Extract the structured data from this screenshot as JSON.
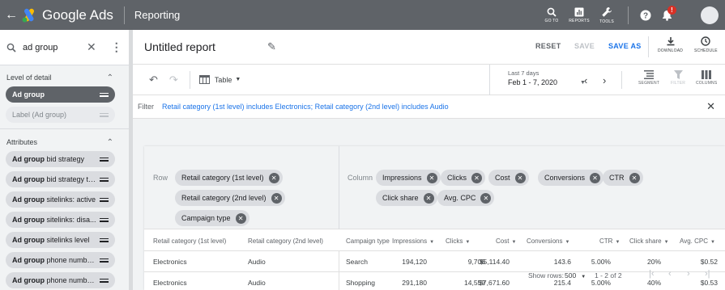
{
  "topbar": {
    "brand": "Google Ads",
    "section": "Reporting",
    "tools": [
      {
        "label": "GO TO",
        "icon": "search-icon"
      },
      {
        "label": "REPORTS",
        "icon": "reports-icon"
      },
      {
        "label": "TOOLS",
        "icon": "wrench-icon"
      }
    ],
    "notification_badge": "!"
  },
  "sidebar": {
    "search_value": "ad group",
    "level_header": "Level of detail",
    "level_items": [
      {
        "prefix": "Ad group",
        "rest": "",
        "state": "selected"
      },
      {
        "prefix": "",
        "rest": "Label (Ad group)",
        "state": "disabled"
      }
    ],
    "attributes_header": "Attributes",
    "attribute_items": [
      {
        "prefix": "Ad group",
        "rest": " bid strategy"
      },
      {
        "prefix": "Ad group",
        "rest": " bid strategy ty..."
      },
      {
        "prefix": "Ad group",
        "rest": " sitelinks: active"
      },
      {
        "prefix": "Ad group",
        "rest": " sitelinks: disa..."
      },
      {
        "prefix": "Ad group",
        "rest": " sitelinks level"
      },
      {
        "prefix": "Ad group",
        "rest": " phone number..."
      },
      {
        "prefix": "Ad group",
        "rest": " phone number..."
      }
    ]
  },
  "report": {
    "title": "Untitled report",
    "reset_label": "RESET",
    "save_label": "SAVE",
    "save_as_label": "SAVE AS",
    "download_label": "DOWNLOAD",
    "schedule_label": "SCHEDULE",
    "view_label": "Table",
    "date_range_label": "Last 7 days",
    "date_range_value": "Feb 1 - 7, 2020",
    "segment_label": "SEGMENT",
    "filter_tool_label": "FILTER",
    "columns_label": "COLUMNS",
    "filter_label": "Filter",
    "filter_text": "Retail category (1st level) includes Electronics; Retail category (2nd level) includes Audio"
  },
  "pivot": {
    "row_label": "Row",
    "rows": [
      "Retail category (1st level)",
      "Retail category (2nd level)",
      "Campaign type"
    ],
    "column_label": "Column",
    "columns": [
      "Impressions",
      "Clicks",
      "Cost",
      "Conversions",
      "CTR",
      "Click share",
      "Avg. CPC"
    ]
  },
  "table": {
    "headers": [
      "Retail category (1st level)",
      "Retail category (2nd level)",
      "Campaign type",
      "Impressions",
      "Clicks",
      "Cost",
      "Conversions",
      "CTR",
      "Click share",
      "Avg. CPC"
    ],
    "rows": [
      [
        "Electronics",
        "Audio",
        "Search",
        "194,120",
        "9,706",
        "$5,114.40",
        "143.6",
        "5.00%",
        "20%",
        "$0.52"
      ],
      [
        "Electronics",
        "Audio",
        "Shopping",
        "291,180",
        "14,559",
        "$7,671.60",
        "215.4",
        "5.00%",
        "40%",
        "$0.53"
      ]
    ],
    "show_rows_label": "Show rows:",
    "show_rows_value": "500",
    "range_text": "1 - 2 of 2"
  },
  "colors": {
    "topbar": "#5f6368",
    "accent_blue": "#1a73e8",
    "save_disabled": "#bdc1c6"
  }
}
